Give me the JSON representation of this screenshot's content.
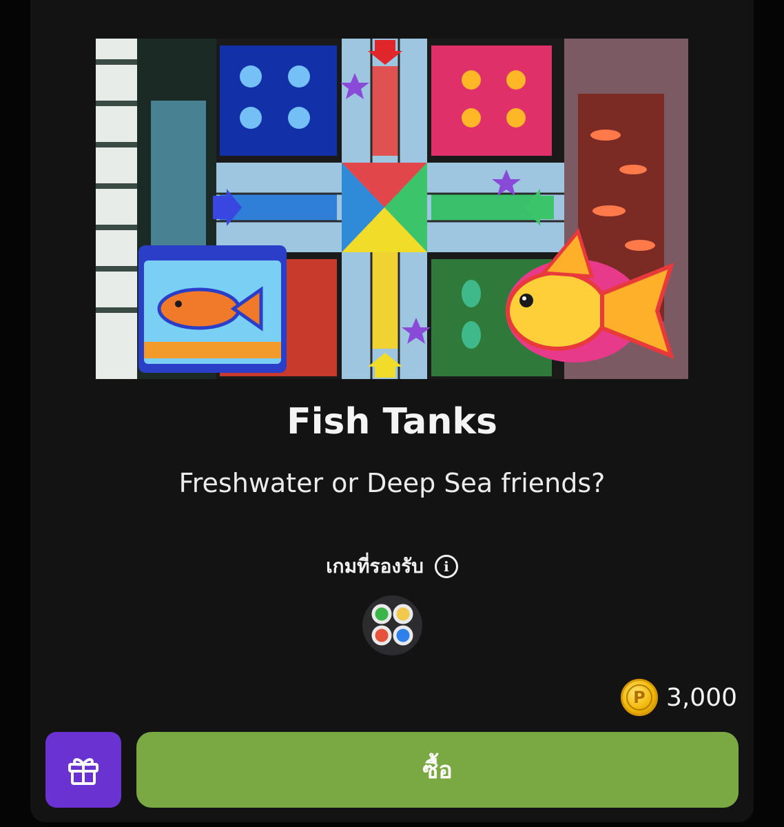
{
  "product": {
    "title": "Fish Tanks",
    "subtitle": "Freshwater or Deep Sea friends?",
    "banner_icon": "fish-tanks-board-artwork"
  },
  "supported_games": {
    "label": "เกมที่รองรับ",
    "info_icon": "info-icon",
    "games": [
      {
        "icon": "ludo-game-icon",
        "dot_colors": [
          "#3bb54a",
          "#f2c94c",
          "#e5533d",
          "#2f80ed"
        ]
      }
    ]
  },
  "price": {
    "coin_icon": "coin-icon",
    "coin_symbol": "P",
    "value": "3,000"
  },
  "actions": {
    "gift_icon": "gift-icon",
    "buy_label": "ซื้อ"
  },
  "colors": {
    "sheet_bg": "#131313",
    "buy_green": "#7aa843",
    "gift_purple": "#6a32d1",
    "coin_gold": "#f0b400"
  }
}
